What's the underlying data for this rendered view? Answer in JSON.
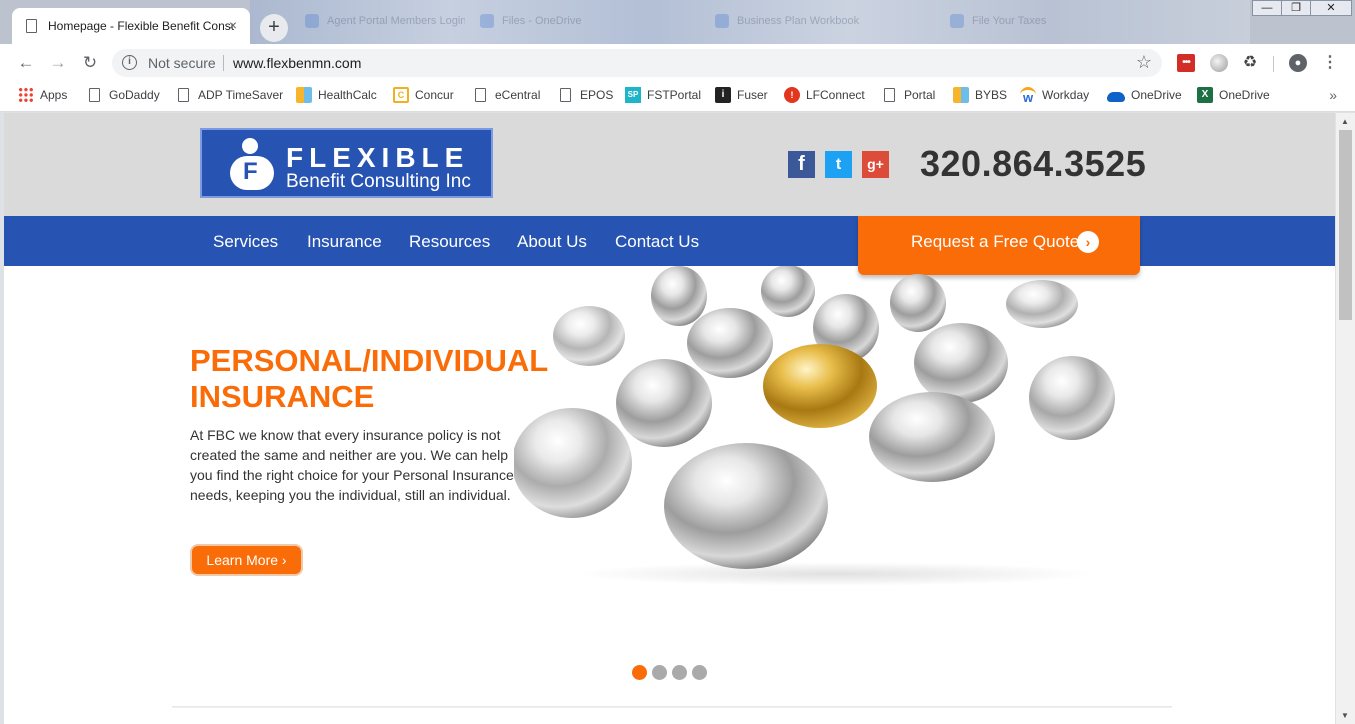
{
  "browser": {
    "active_tab": {
      "title": "Homepage - Flexible Benefit Consulting",
      "close": "×"
    },
    "background_tabs": [
      "Agent Portal Members Login",
      "Files - OneDrive",
      "Business Plan Workbook",
      "File Your Taxes"
    ],
    "new_tab": "+",
    "window_controls": {
      "minimize": "—",
      "maximize": "❐",
      "close": "✕"
    },
    "nav": {
      "back": "←",
      "forward": "→",
      "reload": "↻"
    },
    "address": {
      "security": "Not secure",
      "url": "www.flexbenmn.com",
      "info_glyph": "i",
      "star": "☆"
    },
    "extensions": {
      "lastpass": "•••",
      "recycle": "♻",
      "profile": "●",
      "menu": "⋮"
    },
    "bookmarks": [
      {
        "label": "Apps",
        "icon": "apps-grid-icon"
      },
      {
        "label": "GoDaddy",
        "icon": "page-icon"
      },
      {
        "label": "ADP TimeSaver",
        "icon": "page-icon"
      },
      {
        "label": "HealthCalc",
        "icon": "tiles-icon"
      },
      {
        "label": "Concur",
        "icon": "concur-icon"
      },
      {
        "label": "eCentral",
        "icon": "page-icon"
      },
      {
        "label": "EPOS",
        "icon": "page-icon"
      },
      {
        "label": "FSTPortal",
        "icon": "sp-icon"
      },
      {
        "label": "Fuser",
        "icon": "info-icon"
      },
      {
        "label": "LFConnect",
        "icon": "lf-icon"
      },
      {
        "label": "Portal",
        "icon": "page-icon"
      },
      {
        "label": "BYBS",
        "icon": "tiles-icon"
      },
      {
        "label": "Workday",
        "icon": "workday-icon"
      },
      {
        "label": "OneDrive",
        "icon": "onedrive-icon"
      },
      {
        "label": "OneDrive",
        "icon": "excel-icon"
      }
    ],
    "bookmarks_more": "»"
  },
  "site": {
    "logo": {
      "line1": "FLEXIBLE",
      "line2": "Benefit Consulting Inc",
      "mark_letter": "F"
    },
    "social": {
      "facebook": "f",
      "twitter": "t",
      "googleplus": "g+"
    },
    "phone": "320.864.3525",
    "nav": [
      "Services",
      "Insurance",
      "Resources",
      "About Us",
      "Contact Us"
    ],
    "quote_button": {
      "label": "Request a Free Quote",
      "icon": "›"
    },
    "hero": {
      "title_line1": "PERSONAL/INDIVIDUAL",
      "title_line2": "INSURANCE",
      "body": "At FBC we know that every insurance policy is not created the same and neither are you. We can help you find the right choice for your Personal Insurance needs, keeping you the individual, still an individual.",
      "button": "Learn More ›"
    },
    "carousel": {
      "slides": 4,
      "active": 1
    }
  },
  "colors": {
    "brand_blue": "#2753b3",
    "accent_orange": "#f96c08",
    "header_grey": "#dadada",
    "gold": "#d9a52a"
  }
}
